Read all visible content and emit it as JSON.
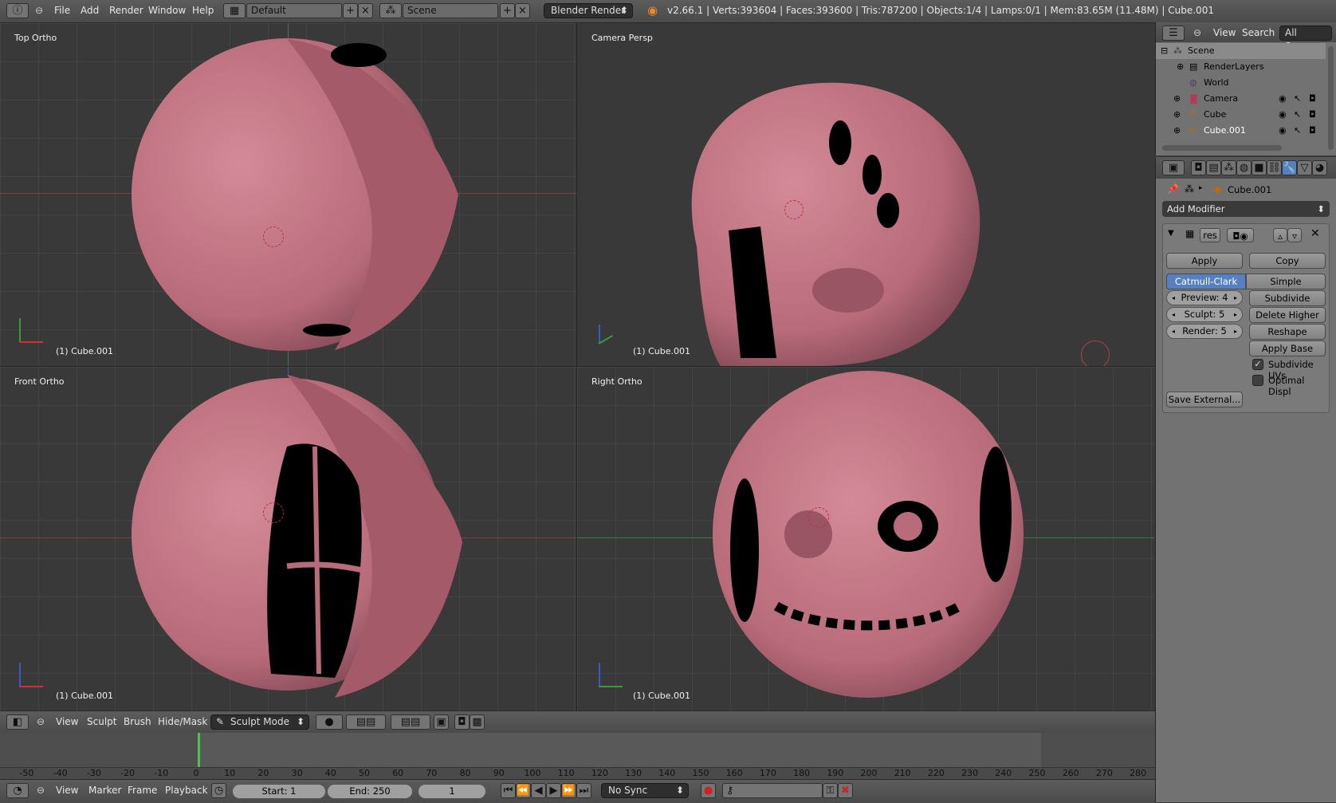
{
  "topbar": {
    "info_icon": "info-icon",
    "menus": [
      "File",
      "Add",
      "Render",
      "Window",
      "Help"
    ],
    "layout_name": "Default",
    "scene_name": "Scene",
    "render_engine": "Blender Render",
    "stats": "v2.66.1 | Verts:393604 | Faces:393600 | Tris:787200 | Objects:1/4 | Lamps:0/1 | Mem:83.65M (11.48M) | Cube.001"
  },
  "viewports": [
    {
      "label": "Top Ortho",
      "object": "(1) Cube.001",
      "axes": [
        "y",
        "x"
      ]
    },
    {
      "label": "Camera Persp",
      "object": "(1) Cube.001",
      "axes": [
        "z",
        "y",
        "x"
      ]
    },
    {
      "label": "Front Ortho",
      "object": "(1) Cube.001",
      "axes": [
        "z",
        "x"
      ]
    },
    {
      "label": "Right Ortho",
      "object": "(1) Cube.001",
      "axes": [
        "z",
        "y"
      ]
    }
  ],
  "outliner": {
    "header": {
      "view": "View",
      "search": "Search",
      "scenes": "All Scenes"
    },
    "items": [
      {
        "name": "Scene",
        "level": 0
      },
      {
        "name": "RenderLayers",
        "level": 1
      },
      {
        "name": "World",
        "level": 1
      },
      {
        "name": "Camera",
        "level": 1
      },
      {
        "name": "Cube",
        "level": 1
      },
      {
        "name": "Cube.001",
        "level": 1
      }
    ]
  },
  "properties": {
    "context_object": "Cube.001",
    "add_modifier": "Add Modifier",
    "modifier_name": "res",
    "apply": "Apply",
    "copy": "Copy",
    "catmull": "Catmull-Clark",
    "simple": "Simple",
    "preview": "Preview: 4",
    "sculpt": "Sculpt: 5",
    "render": "Render: 5",
    "subdivide": "Subdivide",
    "delete_higher": "Delete Higher",
    "reshape": "Reshape",
    "apply_base": "Apply Base",
    "subdivide_uvs": "Subdivide UVs",
    "optimal_displ": "Optimal Displ",
    "save_external": "Save External..."
  },
  "view3d_header": {
    "menus": [
      "View",
      "Sculpt",
      "Brush",
      "Hide/Mask"
    ],
    "mode": "Sculpt Mode"
  },
  "timeline": {
    "ticks": [
      "-50",
      "-40",
      "-30",
      "-20",
      "-10",
      "0",
      "10",
      "20",
      "30",
      "40",
      "50",
      "60",
      "70",
      "80",
      "90",
      "100",
      "110",
      "120",
      "130",
      "140",
      "150",
      "160",
      "170",
      "180",
      "190",
      "200",
      "210",
      "220",
      "230",
      "240",
      "250",
      "260",
      "270",
      "280"
    ],
    "menus": [
      "View",
      "Marker",
      "Frame",
      "Playback"
    ],
    "start": "Start: 1",
    "end": "End: 250",
    "current": "1",
    "sync": "No Sync"
  },
  "colors": {
    "accent": "#5680c2",
    "mesh": "#c27584",
    "bg": "#393939"
  }
}
